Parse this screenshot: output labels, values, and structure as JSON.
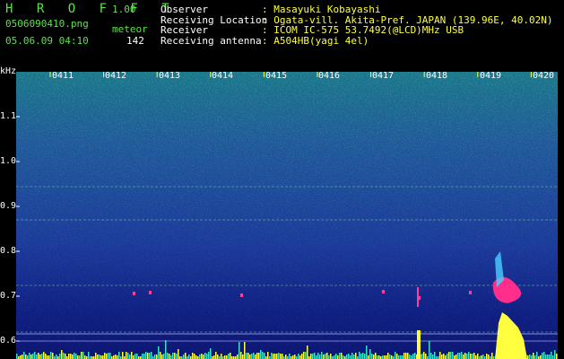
{
  "header": {
    "app_title": "H R O F F T",
    "version": "1.00",
    "filename": "0506090410.png",
    "mode": "meteor",
    "datetime": "05.06.09 04:10",
    "count": "142"
  },
  "meta": [
    {
      "label": "Observer",
      "value": ": Masayuki Kobayashi"
    },
    {
      "label": "Receiving Location",
      "value": ": Ogata-vill. Akita-Pref. JAPAN (139.96E, 40.02N)"
    },
    {
      "label": "Receiver",
      "value": ": ICOM IC-575 53.7492(@LCD)MHz USB"
    },
    {
      "label": "Receiving antenna",
      "value": ": A504HB(yagi 4el)"
    }
  ],
  "axis": {
    "unit": "kHz",
    "y_ticks": [
      "1.1",
      "1.0",
      "0.9",
      "0.8",
      "0.7",
      "0.6"
    ],
    "x_ticks": [
      "0411",
      "0412",
      "0413",
      "0414",
      "0415",
      "0416",
      "0417",
      "0418",
      "0419",
      "0420"
    ]
  },
  "colors": {
    "title_green": "#5de24b",
    "value_yellow": "#ffff40",
    "background": "#000000"
  }
}
